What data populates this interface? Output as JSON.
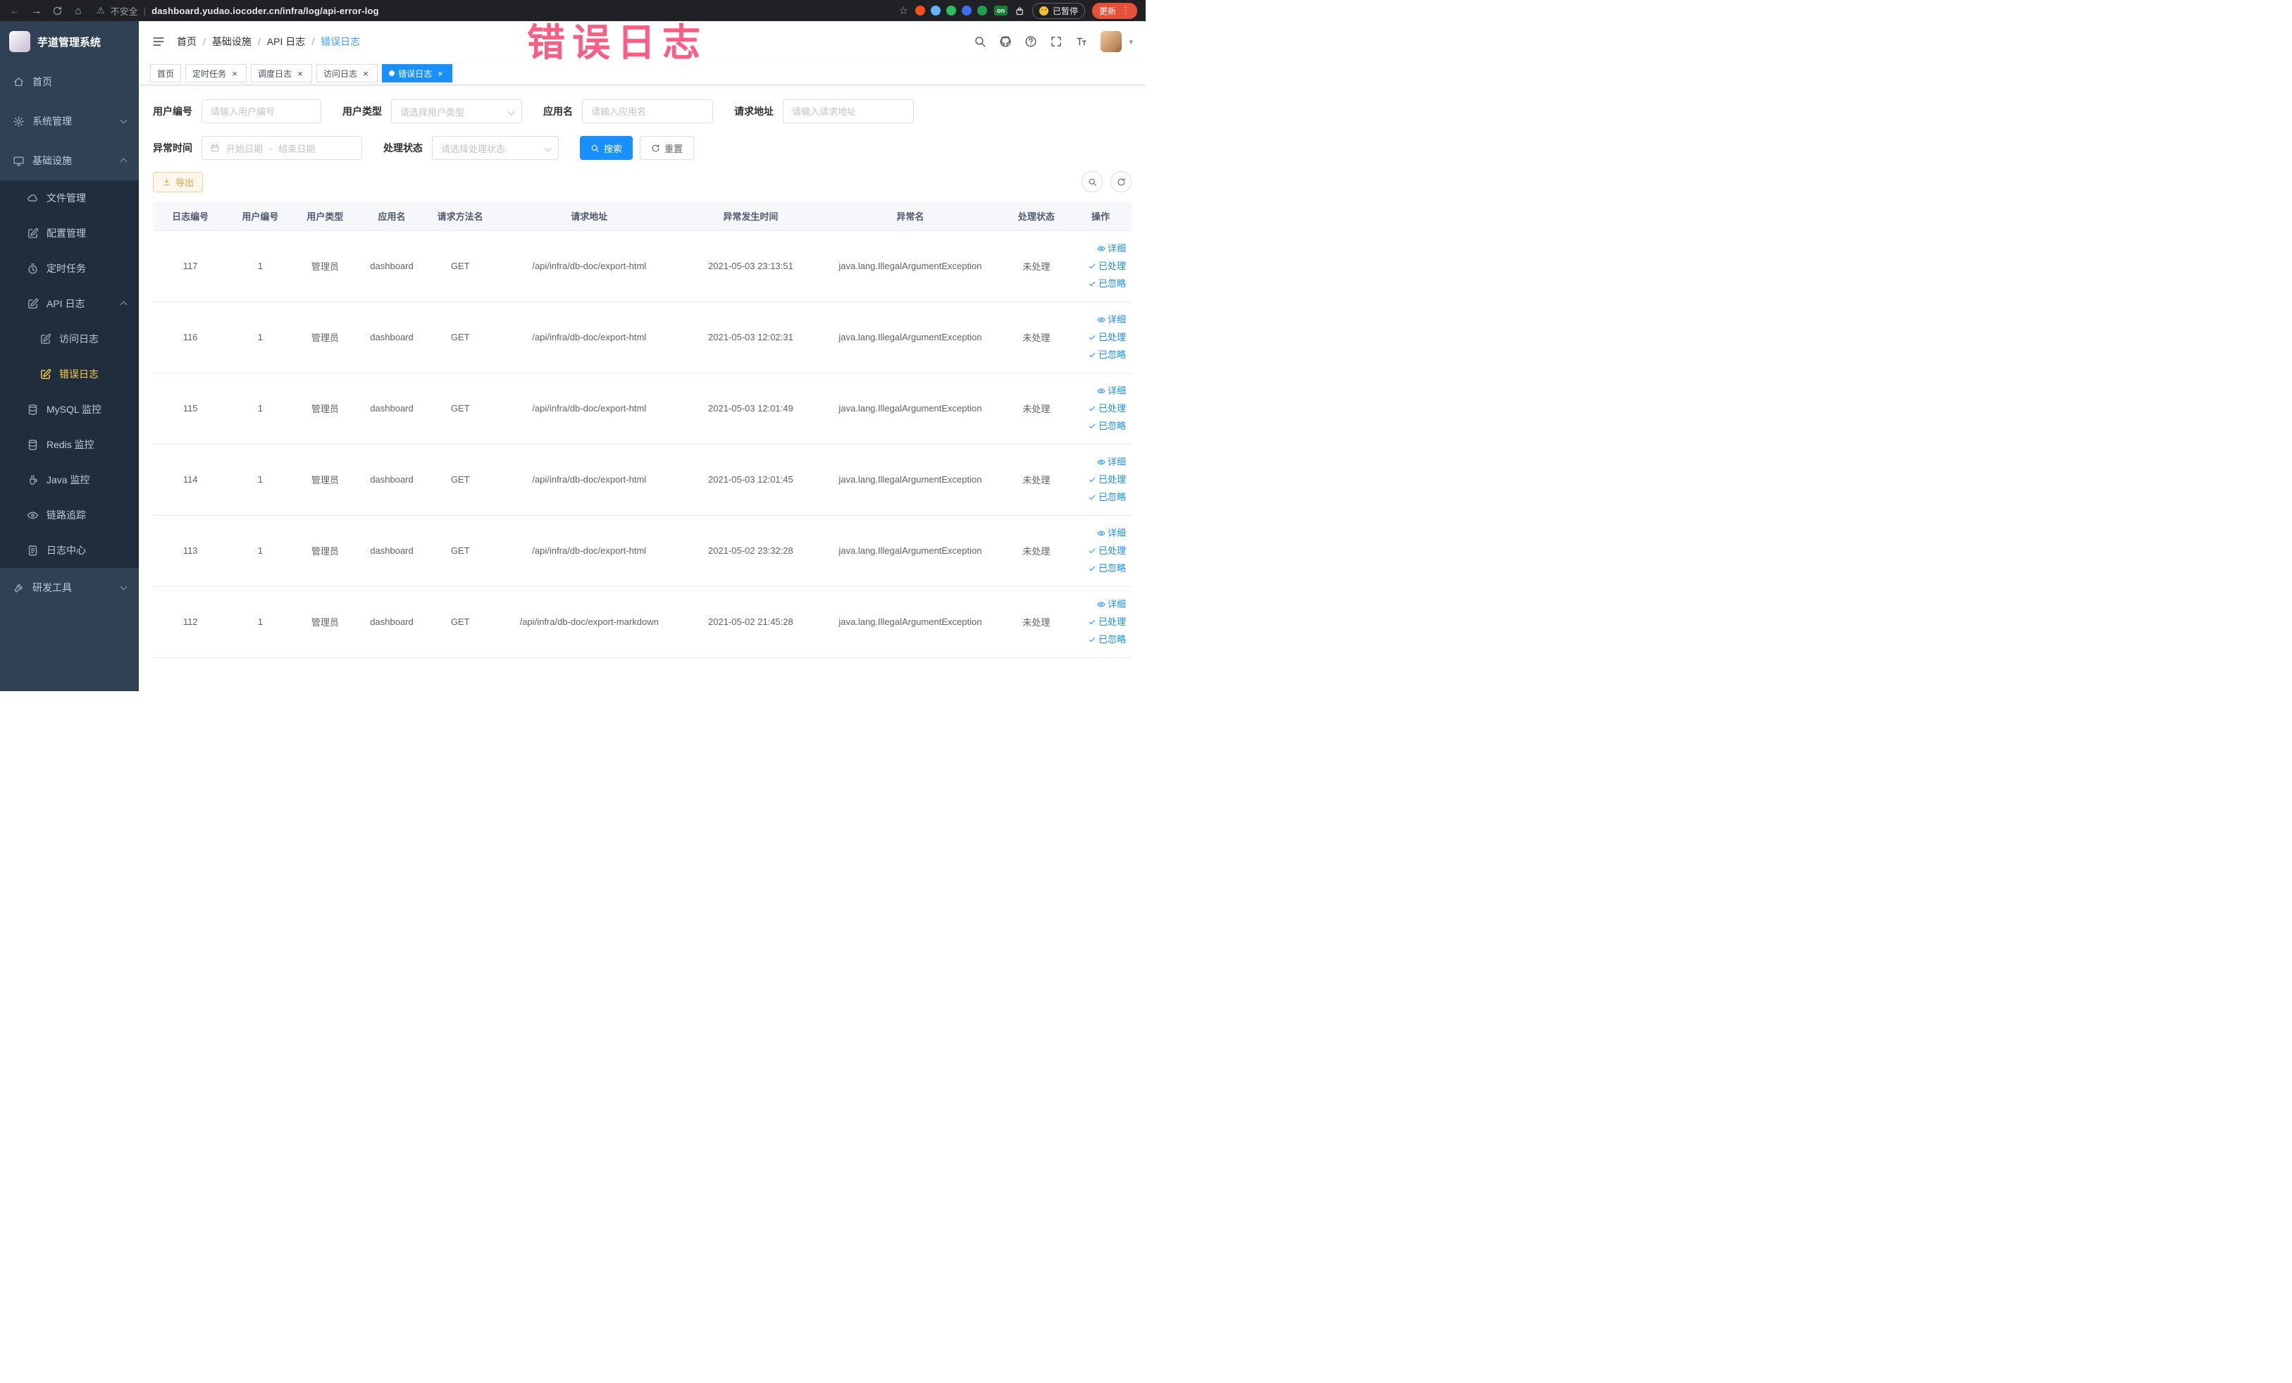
{
  "browser": {
    "security_label": "不安全",
    "url": "dashboard.yudao.iocoder.cn/infra/log/api-error-log",
    "paused_label": "已暂停",
    "update_label": "更新",
    "on_badge": "on",
    "extensions": [
      "#f4511e",
      "#64b5f6",
      "#2dbe60",
      "#3b6ef0",
      "#1e9e52"
    ]
  },
  "icons": {
    "back": "←",
    "forward": "→",
    "home": "⌂",
    "warning": "⚠",
    "divider": "|",
    "star": "☆",
    "kebab": "⋮",
    "caret": "▾",
    "close": "×"
  },
  "overlay": {
    "text": "错误日志"
  },
  "sidebar": {
    "title": "芋道管理系统",
    "items": [
      {
        "key": "home",
        "label": "首页",
        "icon": "home",
        "level": 0
      },
      {
        "key": "system",
        "label": "系统管理",
        "icon": "gear",
        "level": 0,
        "chevron": "down"
      },
      {
        "key": "infra",
        "label": "基础设施",
        "icon": "monitor",
        "level": 0,
        "chevron": "up"
      },
      {
        "key": "file",
        "label": "文件管理",
        "icon": "cloud",
        "level": 1
      },
      {
        "key": "config",
        "label": "配置管理",
        "icon": "edit",
        "level": 1
      },
      {
        "key": "job",
        "label": "定时任务",
        "icon": "timer",
        "level": 1
      },
      {
        "key": "api-log",
        "label": "API 日志",
        "icon": "edit",
        "level": 1,
        "chevron": "up"
      },
      {
        "key": "access-log",
        "label": "访问日志",
        "icon": "edit",
        "level": 2
      },
      {
        "key": "error-log",
        "label": "错误日志",
        "icon": "edit",
        "level": 2,
        "active": true
      },
      {
        "key": "mysql",
        "label": "MySQL 监控",
        "icon": "db",
        "level": 1
      },
      {
        "key": "redis",
        "label": "Redis 监控",
        "icon": "db",
        "level": 1
      },
      {
        "key": "java",
        "label": "Java 监控",
        "icon": "java",
        "level": 1
      },
      {
        "key": "trace",
        "label": "链路追踪",
        "icon": "eye",
        "level": 1
      },
      {
        "key": "log-center",
        "label": "日志中心",
        "icon": "doc",
        "level": 1
      },
      {
        "key": "dev-tools",
        "label": "研发工具",
        "icon": "tools",
        "level": 0,
        "chevron": "down"
      }
    ]
  },
  "topbar": {
    "breadcrumbs": [
      {
        "label": "首页"
      },
      {
        "label": "基础设施"
      },
      {
        "label": "API 日志"
      },
      {
        "label": "错误日志",
        "active": true
      }
    ]
  },
  "tabs": [
    {
      "key": "home",
      "label": "首页",
      "closable": false
    },
    {
      "key": "job",
      "label": "定时任务",
      "closable": true
    },
    {
      "key": "job-log",
      "label": "调度日志",
      "closable": true
    },
    {
      "key": "access-log",
      "label": "访问日志",
      "closable": true
    },
    {
      "key": "error-log",
      "label": "错误日志",
      "closable": true,
      "active": true
    }
  ],
  "filters": {
    "user_id": {
      "label": "用户编号",
      "placeholder": "请输入用户编号"
    },
    "user_type": {
      "label": "用户类型",
      "placeholder": "请选择用户类型"
    },
    "app_name": {
      "label": "应用名",
      "placeholder": "请输入应用名"
    },
    "request_url": {
      "label": "请求地址",
      "placeholder": "请输入请求地址"
    },
    "exception_time": {
      "label": "异常时间",
      "start_placeholder": "开始日期",
      "separator": "-",
      "end_placeholder": "结束日期"
    },
    "process_status": {
      "label": "处理状态",
      "placeholder": "请选择处理状态"
    },
    "search_label": "搜索",
    "reset_label": "重置"
  },
  "toolbar": {
    "export_label": "导出"
  },
  "table": {
    "columns": [
      "日志编号",
      "用户编号",
      "用户类型",
      "应用名",
      "请求方法名",
      "请求地址",
      "异常发生时间",
      "异常名",
      "处理状态",
      "操作"
    ],
    "row_actions": [
      {
        "key": "detail",
        "label": "详细",
        "icon": "eye"
      },
      {
        "key": "done",
        "label": "已处理",
        "icon": "check"
      },
      {
        "key": "ignore",
        "label": "已忽略",
        "icon": "check"
      }
    ],
    "rows": [
      [
        "117",
        "1",
        "管理员",
        "dashboard",
        "GET",
        "/api/infra/db-doc/export-html",
        "2021-05-03 23:13:51",
        "java.lang.IllegalArgumentException",
        "未处理"
      ],
      [
        "116",
        "1",
        "管理员",
        "dashboard",
        "GET",
        "/api/infra/db-doc/export-html",
        "2021-05-03 12:02:31",
        "java.lang.IllegalArgumentException",
        "未处理"
      ],
      [
        "115",
        "1",
        "管理员",
        "dashboard",
        "GET",
        "/api/infra/db-doc/export-html",
        "2021-05-03 12:01:49",
        "java.lang.IllegalArgumentException",
        "未处理"
      ],
      [
        "114",
        "1",
        "管理员",
        "dashboard",
        "GET",
        "/api/infra/db-doc/export-html",
        "2021-05-03 12:01:45",
        "java.lang.IllegalArgumentException",
        "未处理"
      ],
      [
        "113",
        "1",
        "管理员",
        "dashboard",
        "GET",
        "/api/infra/db-doc/export-html",
        "2021-05-02 23:32:28",
        "java.lang.IllegalArgumentException",
        "未处理"
      ],
      [
        "112",
        "1",
        "管理员",
        "dashboard",
        "GET",
        "/api/infra/db-doc/export-markdown",
        "2021-05-02 21:45:28",
        "java.lang.IllegalArgumentException",
        "未处理"
      ]
    ]
  },
  "colors": {
    "accent": "#1890ff",
    "menu_bg": "#304156",
    "submenu_bg": "#1f2d3d",
    "menu_active": "#ffd04b",
    "warning": "#e6a23c",
    "link": "#1890ff",
    "overlay_pink": "#fb426f"
  }
}
